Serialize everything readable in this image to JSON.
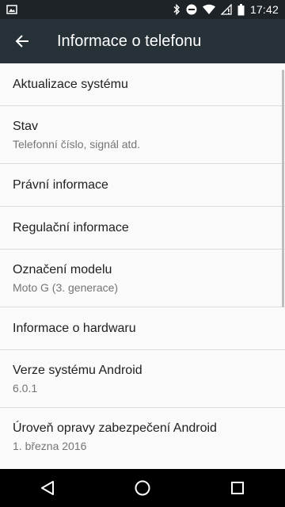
{
  "status_bar": {
    "time": "17:42",
    "icons": [
      "image-notification-icon",
      "bluetooth-icon",
      "do-not-disturb-icon",
      "wifi-icon",
      "no-signal-icon",
      "battery-icon"
    ]
  },
  "toolbar": {
    "back_icon": "arrow-back-icon",
    "title": "Informace o telefonu",
    "background": "#263238"
  },
  "settings": {
    "items": [
      {
        "title": "Aktualizace systému",
        "summary": ""
      },
      {
        "title": "Stav",
        "summary": "Telefonní číslo, signál atd."
      },
      {
        "title": "Právní informace",
        "summary": ""
      },
      {
        "title": "Regulační informace",
        "summary": ""
      },
      {
        "title": "Označení modelu",
        "summary": "Moto G (3. generace)"
      },
      {
        "title": "Informace o hardwaru",
        "summary": ""
      },
      {
        "title": "Verze systému Android",
        "summary": "6.0.1"
      },
      {
        "title": "Úroveň opravy zabezpečení Android",
        "summary": "1. března 2016"
      }
    ]
  },
  "nav_bar": {
    "buttons": [
      "back-triangle-icon",
      "home-circle-icon",
      "recents-square-icon"
    ]
  }
}
